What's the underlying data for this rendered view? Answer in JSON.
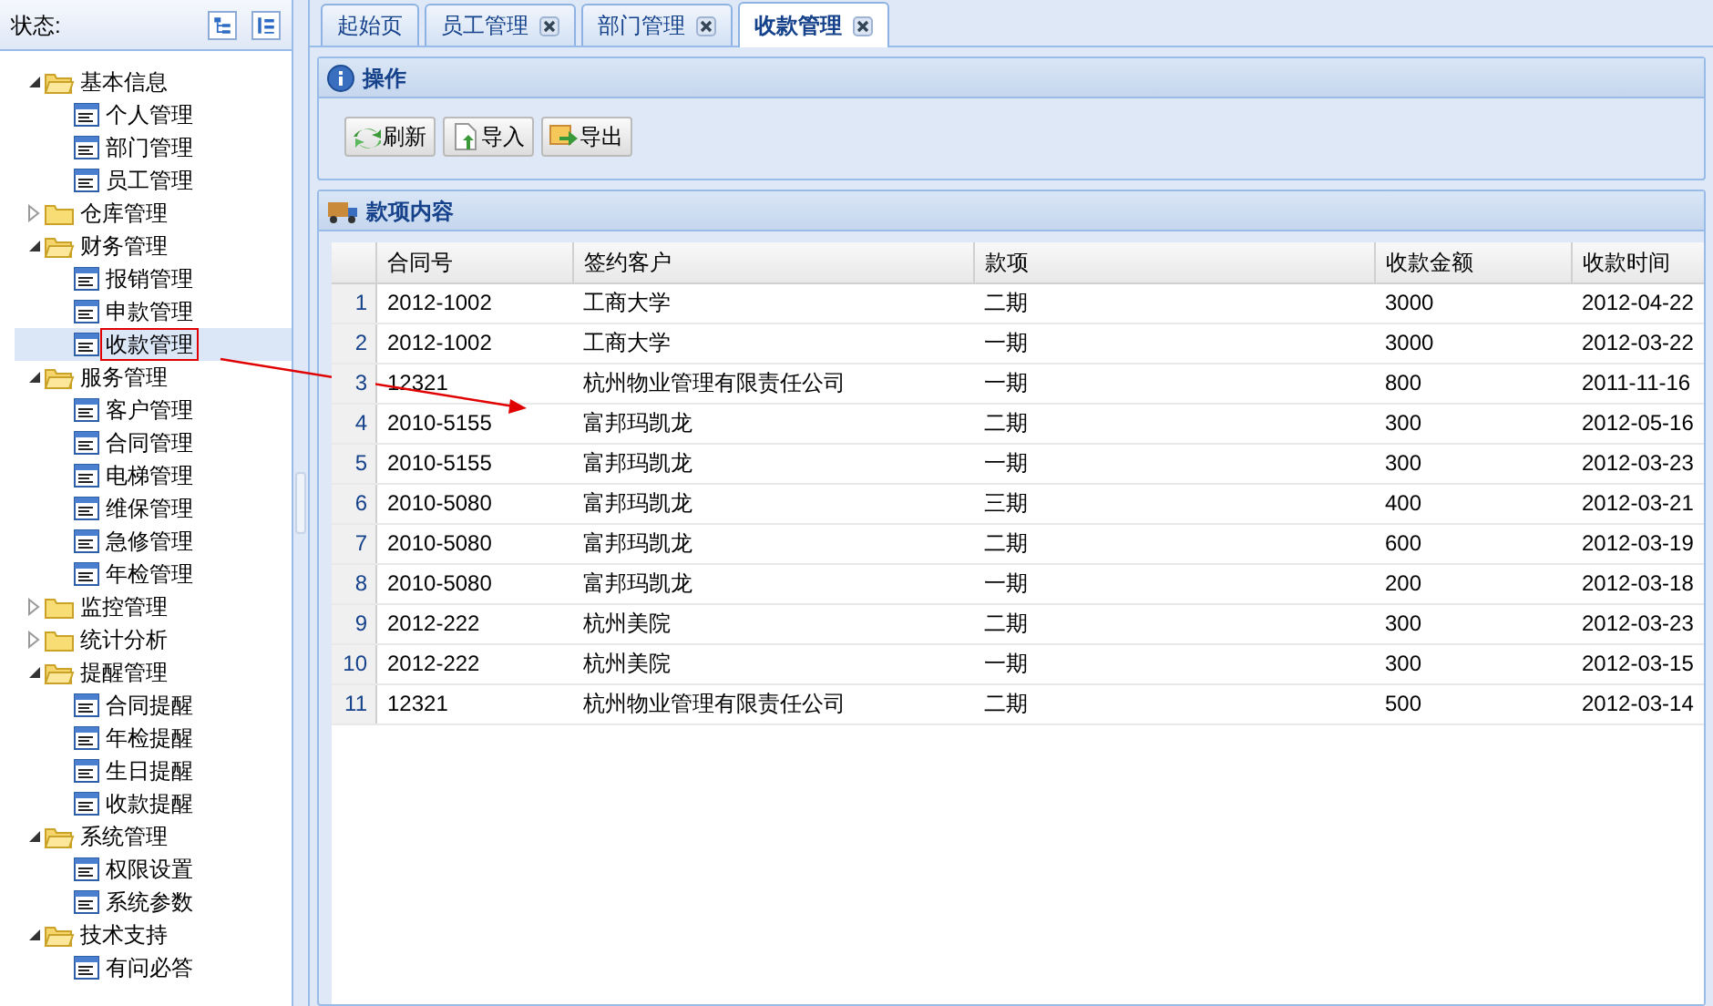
{
  "sidebar": {
    "title": "状态:",
    "tree": [
      {
        "label": "基本信息",
        "expanded": true,
        "children": [
          {
            "label": "个人管理",
            "selected": false,
            "outlined": false
          },
          {
            "label": "部门管理",
            "selected": false,
            "outlined": false
          },
          {
            "label": "员工管理",
            "selected": false,
            "outlined": false
          }
        ]
      },
      {
        "label": "仓库管理",
        "expanded": false
      },
      {
        "label": "财务管理",
        "expanded": true,
        "children": [
          {
            "label": "报销管理",
            "selected": false,
            "outlined": false
          },
          {
            "label": "申款管理",
            "selected": false,
            "outlined": false
          },
          {
            "label": "收款管理",
            "selected": true,
            "outlined": true
          }
        ]
      },
      {
        "label": "服务管理",
        "expanded": true,
        "children": [
          {
            "label": "客户管理",
            "selected": false,
            "outlined": false
          },
          {
            "label": "合同管理",
            "selected": false,
            "outlined": false
          },
          {
            "label": "电梯管理",
            "selected": false,
            "outlined": false
          },
          {
            "label": "维保管理",
            "selected": false,
            "outlined": false
          },
          {
            "label": "急修管理",
            "selected": false,
            "outlined": false
          },
          {
            "label": "年检管理",
            "selected": false,
            "outlined": false
          }
        ]
      },
      {
        "label": "监控管理",
        "expanded": false
      },
      {
        "label": "统计分析",
        "expanded": false
      },
      {
        "label": "提醒管理",
        "expanded": true,
        "children": [
          {
            "label": "合同提醒",
            "selected": false,
            "outlined": false
          },
          {
            "label": "年检提醒",
            "selected": false,
            "outlined": false
          },
          {
            "label": "生日提醒",
            "selected": false,
            "outlined": false
          },
          {
            "label": "收款提醒",
            "selected": false,
            "outlined": false
          }
        ]
      },
      {
        "label": "系统管理",
        "expanded": true,
        "children": [
          {
            "label": "权限设置",
            "selected": false,
            "outlined": false
          },
          {
            "label": "系统参数",
            "selected": false,
            "outlined": false
          }
        ]
      },
      {
        "label": "技术支持",
        "expanded": true,
        "children": [
          {
            "label": "有问必答",
            "selected": false,
            "outlined": false
          }
        ]
      }
    ]
  },
  "tabs": [
    {
      "label": "起始页",
      "selected": false,
      "closable": false
    },
    {
      "label": "员工管理",
      "selected": false,
      "closable": true
    },
    {
      "label": "部门管理",
      "selected": false,
      "closable": true
    },
    {
      "label": "收款管理",
      "selected": true,
      "closable": true
    }
  ],
  "operations_panel": {
    "title": "操作",
    "buttons": [
      {
        "label": "刷新",
        "kind": "refresh"
      },
      {
        "label": "导入",
        "kind": "import"
      },
      {
        "label": "导出",
        "kind": "export"
      }
    ]
  },
  "content_panel": {
    "title": "款项内容",
    "table": {
      "columns": [
        "合同号",
        "签约客户",
        "款项",
        "收款金额",
        "收款时间"
      ],
      "rows": [
        {
          "number": "1",
          "cells": [
            "2012-1002",
            "工商大学",
            "二期",
            "3000",
            "2012-04-22"
          ]
        },
        {
          "number": "2",
          "cells": [
            "2012-1002",
            "工商大学",
            "一期",
            "3000",
            "2012-03-22"
          ]
        },
        {
          "number": "3",
          "cells": [
            "12321",
            "杭州物业管理有限责任公司",
            "一期",
            "800",
            "2011-11-16"
          ]
        },
        {
          "number": "4",
          "cells": [
            "2010-5155",
            "富邦玛凯龙",
            "二期",
            "300",
            "2012-05-16"
          ]
        },
        {
          "number": "5",
          "cells": [
            "2010-5155",
            "富邦玛凯龙",
            "一期",
            "300",
            "2012-03-23"
          ]
        },
        {
          "number": "6",
          "cells": [
            "2010-5080",
            "富邦玛凯龙",
            "三期",
            "400",
            "2012-03-21"
          ]
        },
        {
          "number": "7",
          "cells": [
            "2010-5080",
            "富邦玛凯龙",
            "二期",
            "600",
            "2012-03-19"
          ]
        },
        {
          "number": "8",
          "cells": [
            "2010-5080",
            "富邦玛凯龙",
            "一期",
            "200",
            "2012-03-18"
          ]
        },
        {
          "number": "9",
          "cells": [
            "2012-222",
            "杭州美院",
            "二期",
            "300",
            "2012-03-23"
          ]
        },
        {
          "number": "10",
          "cells": [
            "2012-222",
            "杭州美院",
            "一期",
            "300",
            "2012-03-15"
          ]
        },
        {
          "number": "11",
          "cells": [
            "12321",
            "杭州物业管理有限责任公司",
            "二期",
            "500",
            "2012-03-14"
          ]
        }
      ]
    }
  },
  "annotation": {
    "kind": "arrow"
  }
}
